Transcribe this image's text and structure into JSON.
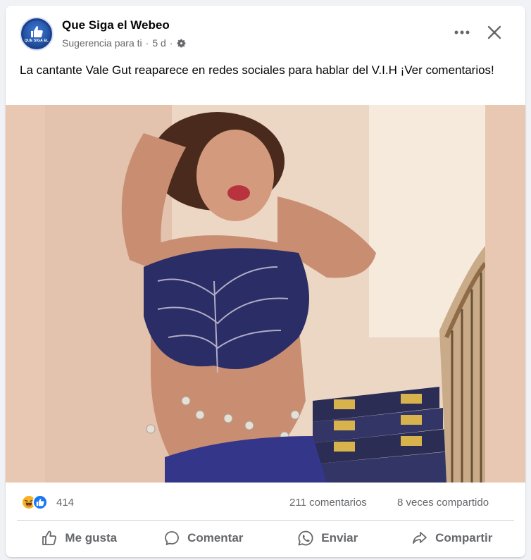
{
  "post": {
    "page_name": "Que Siga el Webeo",
    "avatar_text": "QUE SIGA EL",
    "suggestion": "Sugerencia para ti",
    "separator": "·",
    "time": "5 d",
    "caption": "La cantante Vale Gut reaparece en redes sociales para hablar del V.I.H ¡Ver comentarios!"
  },
  "stats": {
    "reaction_count": "414",
    "comments": "211 comentarios",
    "shares": "8 veces compartido"
  },
  "actions": {
    "like": "Me gusta",
    "comment": "Comentar",
    "send": "Enviar",
    "share": "Compartir"
  },
  "icons": {
    "more": "more-icon",
    "close": "close-icon",
    "audience": "gear-icon",
    "haha": "haha-reaction-icon",
    "like_reaction": "like-reaction-icon"
  },
  "colors": {
    "accent": "#1877f2",
    "secondary_text": "#65676b"
  }
}
